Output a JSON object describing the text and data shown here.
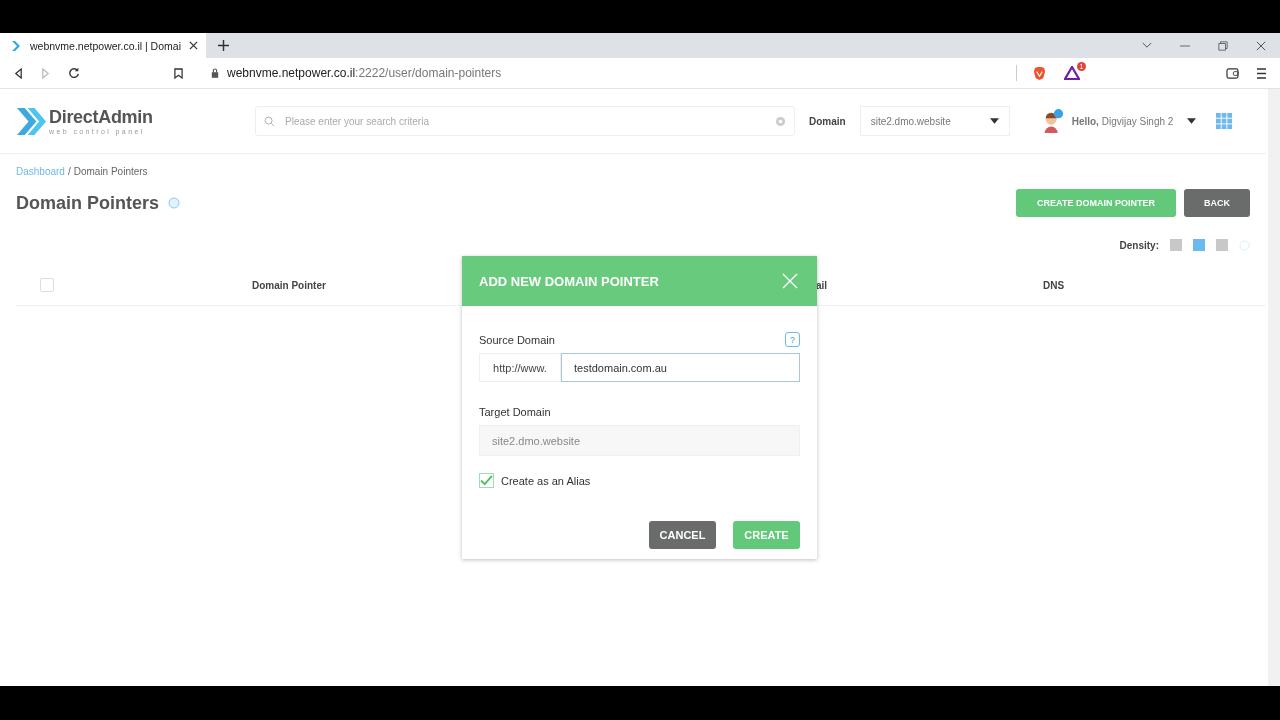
{
  "browser": {
    "tab_title": "webnvme.netpower.co.il | Domai",
    "url_host": "webnvme.netpower.co.il",
    "url_path": ":2222/user/domain-pointers",
    "rewards_badge": "1"
  },
  "header": {
    "logo_title": "DirectAdmin",
    "logo_subtitle": "web control panel",
    "search": {
      "placeholder": "Please enter your search criteria"
    },
    "domain_label": "Domain",
    "domain_value": "site2.dmo.website",
    "greeting": "**Hello,** Digvijay Singh 2"
  },
  "breadcrumb": [
    {
      "label": "Dashboard",
      "kind": "link"
    },
    {
      "label": "/",
      "kind": "separator"
    },
    {
      "label": "Domain Pointers",
      "kind": "current"
    }
  ],
  "title": "Domain Pointers",
  "actions": [
    {
      "label": "CREATE DOMAIN POINTER",
      "kind": "primary"
    },
    {
      "label": "BACK",
      "kind": "secondary"
    }
  ],
  "density": {
    "label": "Density:",
    "options": [
      {
        "selected": false
      },
      {
        "selected": true
      },
      {
        "selected": false
      }
    ]
  },
  "table": {
    "select_all": {
      "checked": false
    },
    "columns": [
      "Domain Pointer",
      "ail",
      "DNS"
    ]
  },
  "modal": {
    "title": "ADD NEW DOMAIN POINTER",
    "source_label": "Source Domain",
    "help": "?",
    "source_prefix": "http://www.",
    "source_value": "testdomain.com.au",
    "target_label": "Target Domain",
    "target": {
      "value": "site2.dmo.website",
      "disabled": true
    },
    "alias": {
      "label": "Create as an Alias",
      "checked": true
    },
    "buttons": [
      {
        "label": "CANCEL",
        "kind": "secondary"
      },
      {
        "label": "CREATE",
        "kind": "primary"
      }
    ]
  }
}
